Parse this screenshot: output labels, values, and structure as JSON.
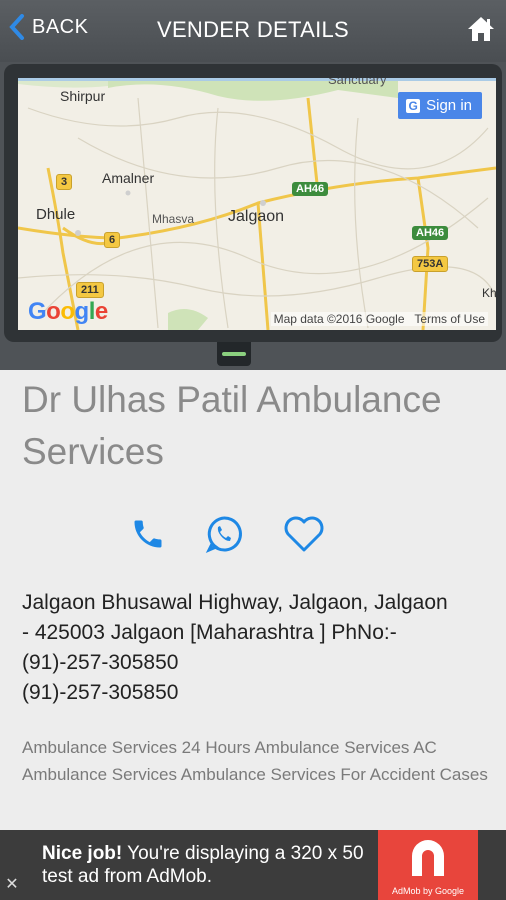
{
  "header": {
    "back_label": "BACK",
    "title": "VENDER DETAILS",
    "back_icon": "chevron-left-icon",
    "home_icon": "home-icon"
  },
  "map": {
    "signin_label": "Sign in",
    "attribution": "Map data ©2016 Google",
    "terms": "Terms of Use",
    "google_logo": "Google",
    "places": [
      "Sanctuary",
      "Shirpur",
      "Amalner",
      "Dhule",
      "Mhasva",
      "Jalgaon",
      "Kh"
    ],
    "roads": [
      "3",
      "AH46",
      "AH46",
      "6",
      "211",
      "753A"
    ]
  },
  "vendor": {
    "name": "Dr Ulhas Patil Ambulance Services",
    "address": "Jalgaon Bhusawal Highway, Jalgaon, Jalgaon - 425003 Jalgaon [Maharashtra ] PhNo:- (91)-257-305850 (91)-257-305850",
    "address_line1": "Jalgaon Bhusawal Highway, Jalgaon, Jalgaon",
    "address_line2": "- 425003 Jalgaon [Maharashtra ] PhNo:-",
    "phone1": "(91)-257-305850",
    "phone2": "(91)-257-305850",
    "services": "Ambulance Services 24 Hours Ambulance Services AC Ambulance Services Ambulance Services For Accident Cases"
  },
  "actions": {
    "icons": [
      "phone-icon",
      "whatsapp-icon",
      "heart-icon"
    ],
    "color": "#1e88e5"
  },
  "ad": {
    "bold": "Nice job!",
    "text": " You're displaying a 320 x 50 test ad from AdMob.",
    "byline": "AdMob by Google",
    "close": "✕"
  },
  "colors": {
    "header_bg": "#4f5357",
    "accent": "#1e88e5",
    "ad_brand": "#e8453c"
  }
}
